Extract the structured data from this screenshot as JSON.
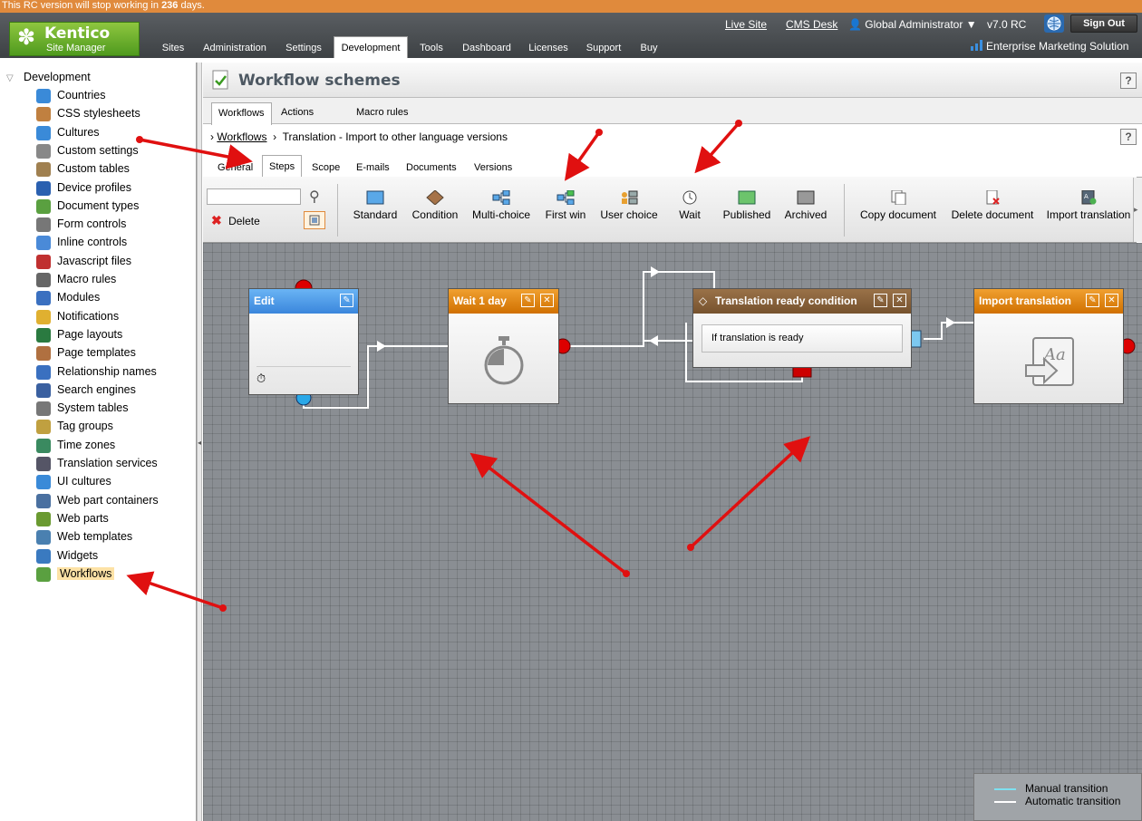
{
  "notice": {
    "prefix": "This RC version will stop working in ",
    "days": "236",
    "suffix": " days."
  },
  "header": {
    "logo_brand": "Kentico",
    "logo_sub": "Site Manager",
    "live_site": "Live Site",
    "cms_desk": "CMS Desk",
    "user": "Global Administrator",
    "version": "v7.0 RC",
    "sign_out": "Sign Out",
    "edition": "Enterprise Marketing Solution",
    "tabs": [
      "Sites",
      "Administration",
      "Settings",
      "Development",
      "Tools",
      "Dashboard",
      "Licenses",
      "Support",
      "Buy"
    ],
    "active_tab": "Development"
  },
  "tree": {
    "root": "Development",
    "items": [
      "Countries",
      "CSS stylesheets",
      "Cultures",
      "Custom settings",
      "Custom tables",
      "Device profiles",
      "Document types",
      "Form controls",
      "Inline controls",
      "Javascript files",
      "Macro rules",
      "Modules",
      "Notifications",
      "Page layouts",
      "Page templates",
      "Relationship names",
      "Search engines",
      "System tables",
      "Tag groups",
      "Time zones",
      "Translation services",
      "UI cultures",
      "Web part containers",
      "Web parts",
      "Web templates",
      "Widgets",
      "Workflows"
    ],
    "selected": "Workflows"
  },
  "page": {
    "title": "Workflow schemes",
    "help": "?",
    "subtabs": [
      "Workflows",
      "Actions",
      "Macro rules"
    ],
    "breadcrumb_link": "Workflows",
    "breadcrumb_current": "Translation - Import to other language versions",
    "steptabs": [
      "General",
      "Steps",
      "Scope",
      "E-mails",
      "Documents",
      "Versions"
    ]
  },
  "toolbar": {
    "search_placeholder": "",
    "delete": "Delete",
    "steps": [
      "Standard",
      "Condition",
      "Multi-choice",
      "First win",
      "User choice",
      "Wait",
      "Published",
      "Archived"
    ],
    "actions": [
      "Copy document",
      "Delete document",
      "Import translation"
    ]
  },
  "nodes": {
    "edit": {
      "title": "Edit"
    },
    "wait": {
      "title": "Wait 1 day"
    },
    "condition": {
      "title": "Translation ready condition",
      "case": "If translation is ready"
    },
    "import": {
      "title": "Import translation"
    }
  },
  "legend": {
    "manual": "Manual transition",
    "automatic": "Automatic transition"
  },
  "colors": {
    "accent_orange": "#e08a3c",
    "edit_header": "#4a90e0",
    "wait_header": "#e07a10",
    "condition_header": "#8a6238",
    "arrow_red": "#e01010"
  }
}
